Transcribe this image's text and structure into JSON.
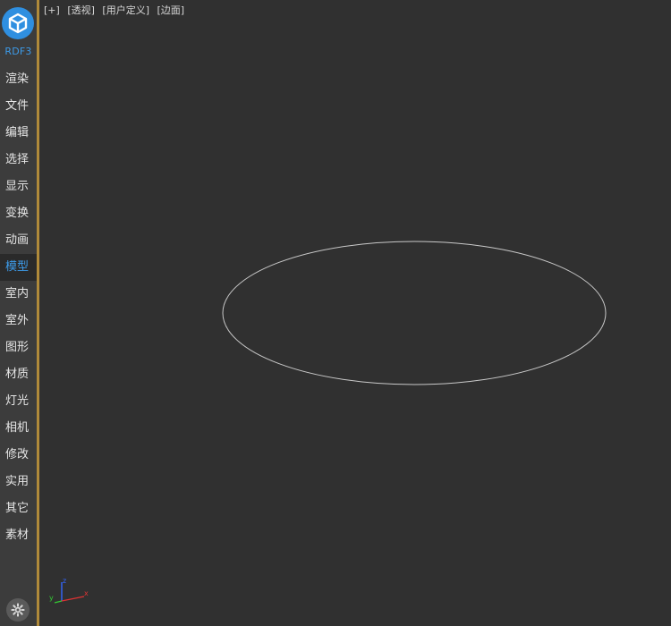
{
  "sidebar": {
    "brand": "RDF3",
    "items": [
      {
        "label": "渲染",
        "active": false
      },
      {
        "label": "文件",
        "active": false
      },
      {
        "label": "编辑",
        "active": false
      },
      {
        "label": "选择",
        "active": false
      },
      {
        "label": "显示",
        "active": false
      },
      {
        "label": "变换",
        "active": false
      },
      {
        "label": "动画",
        "active": false
      },
      {
        "label": "模型",
        "active": true
      },
      {
        "label": "室内",
        "active": false
      },
      {
        "label": "室外",
        "active": false
      },
      {
        "label": "图形",
        "active": false
      },
      {
        "label": "材质",
        "active": false
      },
      {
        "label": "灯光",
        "active": false
      },
      {
        "label": "相机",
        "active": false
      },
      {
        "label": "修改",
        "active": false
      },
      {
        "label": "实用",
        "active": false
      },
      {
        "label": "其它",
        "active": false
      },
      {
        "label": "素材",
        "active": false
      }
    ],
    "settings_icon": "gear-icon",
    "accent_color": "#3d9be9",
    "border_color": "#b08a3a"
  },
  "viewport": {
    "labels": [
      "[+]",
      "[透视]",
      "[用户定义]",
      "[边面]"
    ],
    "object": "ellipse",
    "axes": {
      "x": "x",
      "y": "y",
      "z": "z"
    },
    "axis_colors": {
      "x": "#d33",
      "y": "#3c3",
      "z": "#36f"
    }
  }
}
